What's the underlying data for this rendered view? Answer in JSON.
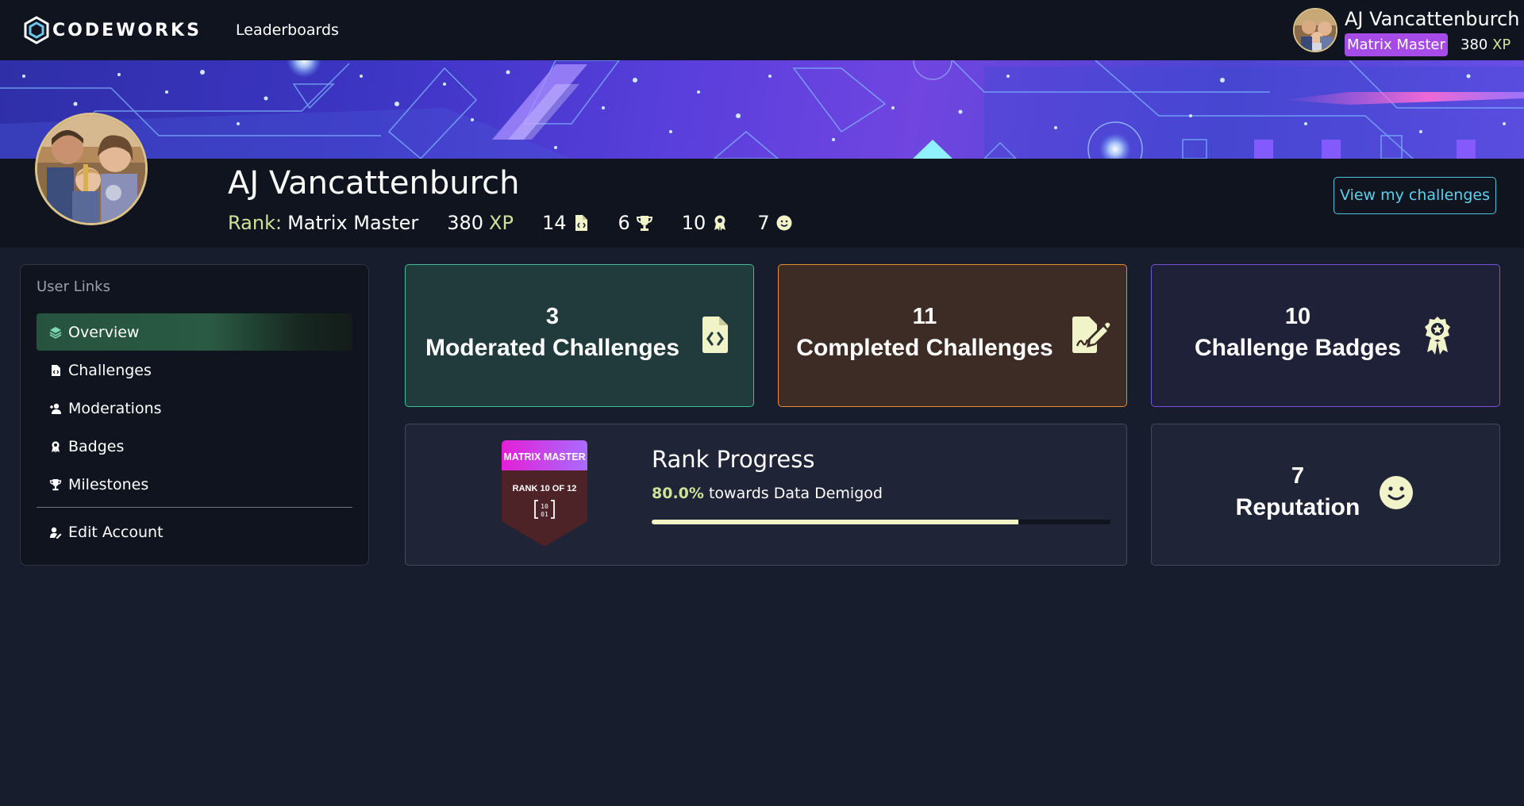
{
  "nav": {
    "logo_text": "CODEWORKS",
    "leaderboards": "Leaderboards",
    "username": "AJ Vancattenburch",
    "rank": "Matrix Master",
    "xp_value": "380",
    "xp_unit": "XP"
  },
  "profile": {
    "name": "AJ Vancattenburch",
    "rank_label": "Rank:",
    "rank": "Matrix Master",
    "xp_value": "380",
    "xp_unit": "XP",
    "challenges_count": "14",
    "milestones_count": "6",
    "badges_count": "10",
    "reputation_count": "7",
    "view_button": "View my challenges"
  },
  "sidebar": {
    "title": "User Links",
    "items": [
      {
        "label": "Overview",
        "icon": "layers-icon",
        "active": true
      },
      {
        "label": "Challenges",
        "icon": "file-code-icon"
      },
      {
        "label": "Moderations",
        "icon": "user-plus-icon"
      },
      {
        "label": "Badges",
        "icon": "award-icon"
      },
      {
        "label": "Milestones",
        "icon": "trophy-icon"
      }
    ],
    "edit_account": "Edit Account"
  },
  "cards": {
    "moderated": {
      "value": "3",
      "label": "Moderated Challenges",
      "icon": "file-code-icon"
    },
    "completed": {
      "value": "11",
      "label": "Completed Challenges",
      "icon": "signature-icon"
    },
    "badges": {
      "value": "10",
      "label": "Challenge Badges",
      "icon": "award-icon"
    },
    "reputation": {
      "value": "7",
      "label": "Reputation",
      "icon": "smile-icon"
    }
  },
  "rank_progress": {
    "title": "Rank Progress",
    "percent_text": "80.0%",
    "towards_text": "towards Data Demigod",
    "progress": 0.8,
    "shield_title": "MATRIX MASTER",
    "shield_rank": "RANK 10 OF 12"
  },
  "colors": {
    "background": "#181d2d",
    "nav": "#0f141e",
    "accent_purple": "#a64ae8",
    "accent_yellow": "#cfe29a",
    "teal": "#3dbf96",
    "orange": "#e98b2f",
    "violet": "#7b4fe0",
    "cyan": "#5fd0ec"
  }
}
